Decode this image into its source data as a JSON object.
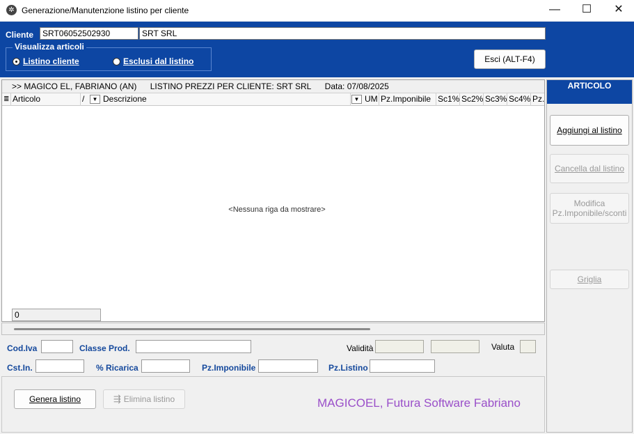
{
  "window": {
    "title": "Generazione/Manutenzione listino per cliente",
    "icon": "app-gear-icon",
    "minimize": "—",
    "maximize": "☐",
    "close": "✕"
  },
  "header": {
    "cliente_label": "Cliente",
    "cliente_code": "SRT06052502930",
    "cliente_name": "SRT SRL",
    "visualizza_title": "Visualizza articoli",
    "radio_listino_label": "Listino cliente",
    "radio_esclusi_label": "Esclusi dal listino",
    "selected_radio": "listino",
    "esci_label": "Esci (ALT-F4)"
  },
  "grid": {
    "caption_items": [
      ">> MAGICO EL, FABRIANO (AN)",
      "LISTINO PREZZI PER CLIENTE: SRT SRL",
      "Data: 07/08/2025"
    ],
    "columns": {
      "articolo": "Articolo",
      "slash": "/",
      "descrizione": "Descrizione",
      "um": "UM",
      "pz_imponibile": "Pz.Imponibile",
      "sc1": "Sc1%",
      "sc2": "Sc2%",
      "sc3": "Sc3%",
      "sc4": "Sc4%",
      "pz": "Pz."
    },
    "empty_message": "<Nessuna riga da mostrare>",
    "row_count": "0"
  },
  "form": {
    "cod_iva_label": "Cod.Iva",
    "classe_prod_label": "Classe Prod.",
    "validita_label": "Validità",
    "valuta_label": "Valuta",
    "cst_in_label": "Cst.In.",
    "ricarica_label": "% Ricarica",
    "pz_imponibile_label": "Pz.Imponibile",
    "pz_listino_label": "Pz.Listino"
  },
  "actions": {
    "genera_label": "Genera listino",
    "elimina_label": "Elimina listino",
    "elimina_icon": "sliders-icon"
  },
  "brand": "MAGICOEL, Futura Software Fabriano",
  "side": {
    "title": "ARTICOLO",
    "aggiungi_label": "Aggiungi al listino",
    "cancella_label": "Cancella dal listino",
    "modifica_label": "Modifica\nPz.Imponibile/sconti",
    "griglia_label": "Griglia"
  },
  "colors": {
    "header_blue": "#0d46a3",
    "label_blue": "#14489c",
    "brand_purple": "#9a4fc9"
  }
}
